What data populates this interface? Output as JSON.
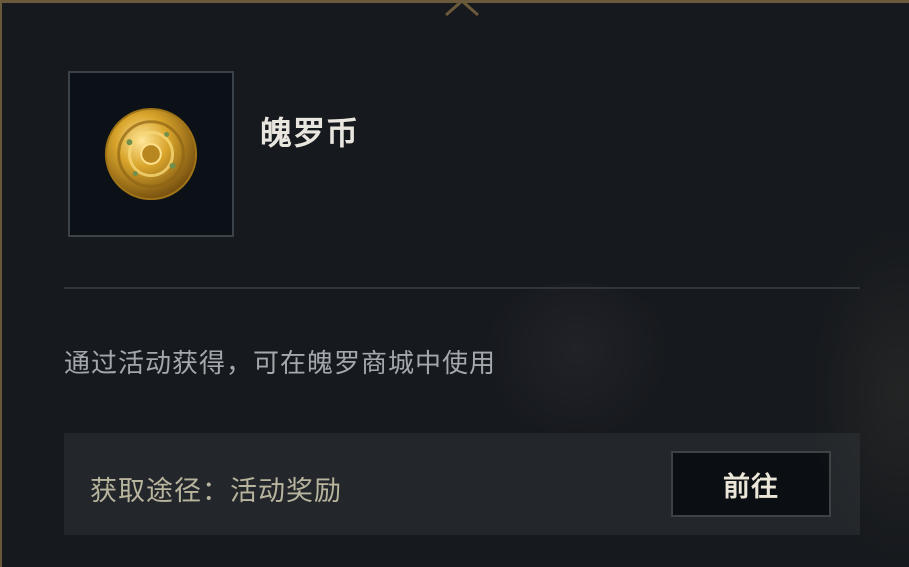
{
  "item": {
    "name": "魄罗币",
    "icon": "gold-coin-icon",
    "description": "通过活动获得，可在魄罗商城中使用"
  },
  "source": {
    "label": "获取途径：活动奖励",
    "button_label": "前往"
  },
  "colors": {
    "frame_gold": "#6a5a3b",
    "panel_bg": "#16191d",
    "source_bg": "#23272b",
    "coin_gold": "#d6a52c"
  }
}
